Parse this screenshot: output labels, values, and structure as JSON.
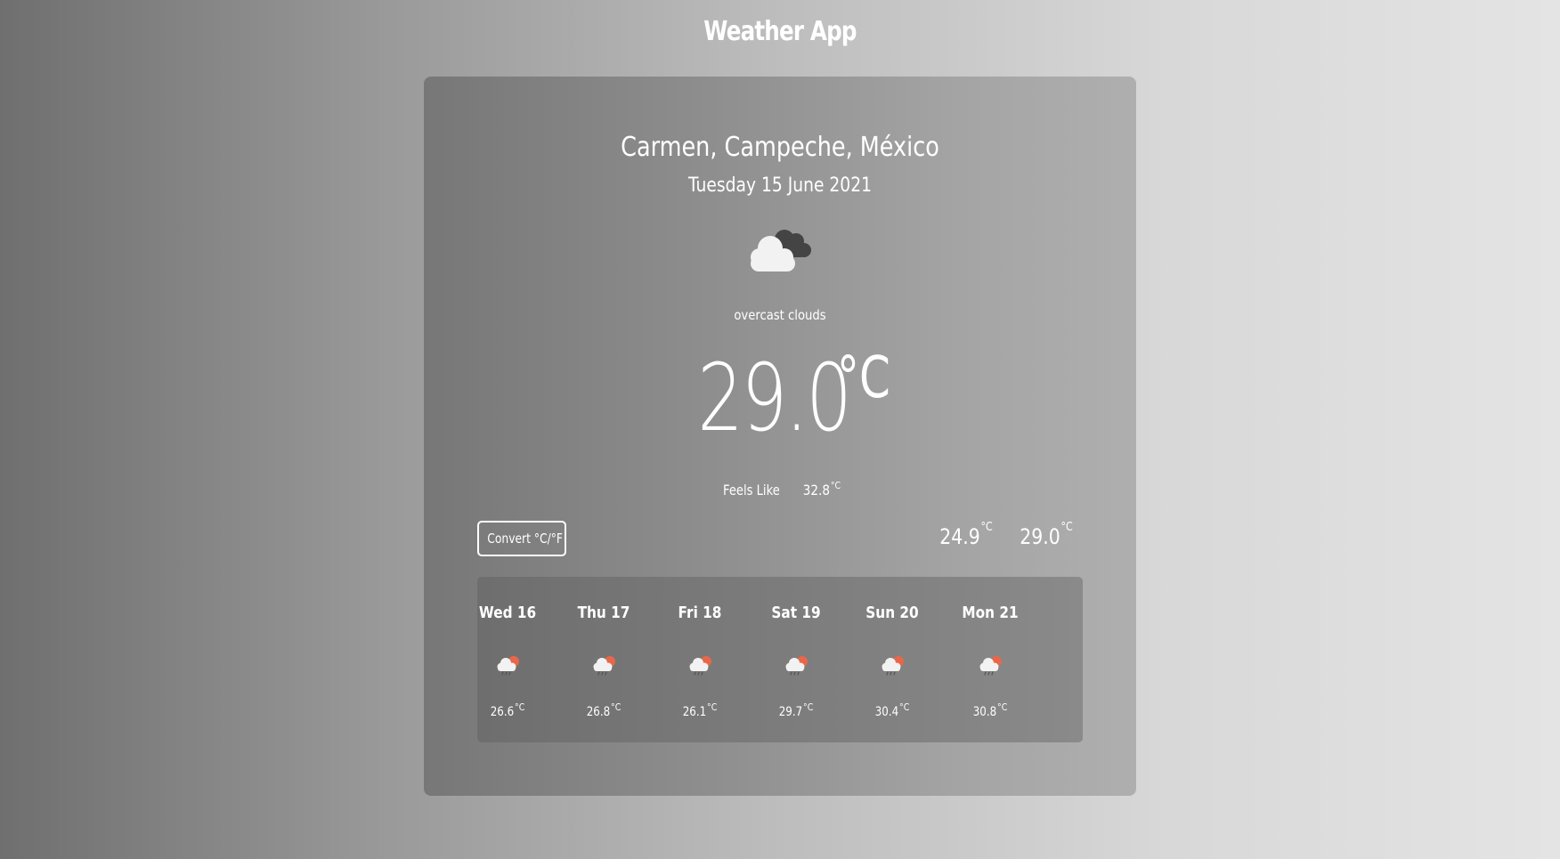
{
  "app": {
    "title": "Weather App"
  },
  "current": {
    "location": "Carmen, Campeche, México",
    "date": "Tuesday 15 June 2021",
    "icon": "overcast-clouds-icon",
    "description": "overcast clouds",
    "temperature": "29.0",
    "unit": "°C",
    "feels_like_label": "Feels Like",
    "feels_like": "32.8",
    "min_temp": "24.9",
    "max_temp": "29.0"
  },
  "controls": {
    "convert_label": "Convert °C/°F"
  },
  "forecast": [
    {
      "day": "Wed 16",
      "icon": "rain-sun-cloud-icon",
      "temp": "26.6",
      "unit": "°C"
    },
    {
      "day": "Thu 17",
      "icon": "rain-sun-cloud-icon",
      "temp": "26.8",
      "unit": "°C"
    },
    {
      "day": "Fri 18",
      "icon": "rain-sun-cloud-icon",
      "temp": "26.1",
      "unit": "°C"
    },
    {
      "day": "Sat 19",
      "icon": "rain-sun-cloud-icon",
      "temp": "29.7",
      "unit": "°C"
    },
    {
      "day": "Sun 20",
      "icon": "rain-sun-cloud-icon",
      "temp": "30.4",
      "unit": "°C"
    },
    {
      "day": "Mon 21",
      "icon": "rain-sun-cloud-icon",
      "temp": "30.8",
      "unit": "°C"
    }
  ],
  "colors": {
    "text": "#ffffff",
    "cloud_light": "#f2f2f2",
    "cloud_dark": "#444444",
    "sun": "#e8674a"
  }
}
